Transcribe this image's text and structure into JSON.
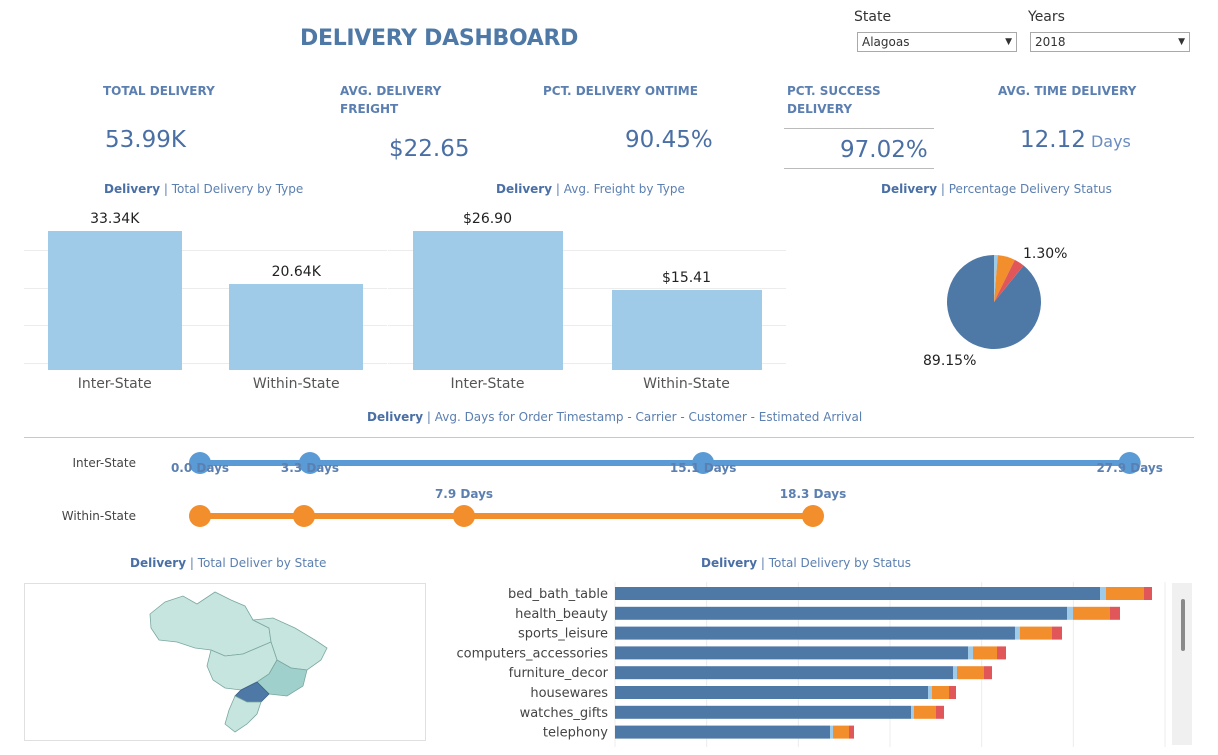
{
  "dashboard": {
    "title": "DELIVERY DASHBOARD"
  },
  "filters": {
    "state": {
      "label": "State",
      "value": "Alagoas"
    },
    "years": {
      "label": "Years",
      "value": "2018"
    }
  },
  "kpis": [
    {
      "label": "TOTAL DELIVERY",
      "value": "53.99K",
      "unit": ""
    },
    {
      "label": "AVG. DELIVERY FREIGHT",
      "value": "$22.65",
      "unit": ""
    },
    {
      "label": "PCT. DELIVERY ONTIME",
      "value": "90.45%",
      "unit": ""
    },
    {
      "label": "PCT. SUCCESS DELIVERY",
      "value": "97.02%",
      "unit": ""
    },
    {
      "label": "AVG. TIME DELIVERY",
      "value": "12.12",
      "unit": "Days"
    }
  ],
  "chart_titles": {
    "prefix": "Delivery",
    "total_by_type": "| Total Delivery by Type",
    "freight_by_type": "| Avg. Freight by Type",
    "status_pct": "| Percentage Delivery Status",
    "avg_days": "| Avg. Days for Order Timestamp - Carrier - Customer - Estimated Arrival",
    "by_state": "| Total Deliver by State",
    "by_status": "| Total Delivery by Status"
  },
  "chart_data": [
    {
      "type": "bar",
      "categories": [
        "Inter-State",
        "Within-State"
      ],
      "values": [
        33.34,
        20.64
      ],
      "value_labels": [
        "33.34K",
        "20.64K"
      ],
      "title": "Delivery | Total Delivery by Type",
      "ylim": [
        0,
        36
      ]
    },
    {
      "type": "bar",
      "categories": [
        "Inter-State",
        "Within-State"
      ],
      "values": [
        26.9,
        15.41
      ],
      "value_labels": [
        "$26.90",
        "$15.41"
      ],
      "title": "Delivery | Avg. Freight by Type",
      "ylim": [
        0,
        29
      ]
    },
    {
      "type": "pie",
      "title": "Delivery | Percentage Delivery Status",
      "slices": [
        {
          "value": 89.15,
          "label": "89.15%",
          "color": "#4e79a7"
        },
        {
          "value": 1.3,
          "label": "1.30%",
          "color": "#a0cbe8"
        },
        {
          "value": 6.0,
          "label": "",
          "color": "#f28e2b"
        },
        {
          "value": 3.55,
          "label": "",
          "color": "#e15759"
        }
      ]
    },
    {
      "type": "line",
      "title": "Delivery | Avg. Days for Order Timestamp - Carrier - Customer - Estimated Arrival",
      "series": [
        {
          "name": "Inter-State",
          "values": [
            0.0,
            3.3,
            15.1,
            27.9
          ],
          "labels": [
            "0.0 Days",
            "3.3 Days",
            "15.1 Days",
            "27.9 Days"
          ],
          "color": "#5b9bd5"
        },
        {
          "name": "Within-State",
          "values": [
            0.0,
            3.1,
            7.9,
            18.3
          ],
          "labels": [
            "",
            "",
            "7.9 Days",
            "18.3 Days"
          ],
          "color": "#f28e2b"
        }
      ],
      "xlim": [
        0,
        28
      ]
    },
    {
      "type": "bar",
      "title": "Delivery | Total Delivery by Status",
      "categories": [
        "bed_bath_table",
        "health_beauty",
        "sports_leisure",
        "computers_accessories",
        "furniture_decor",
        "housewares",
        "watches_gifts",
        "telephony"
      ],
      "series": [
        {
          "name": "",
          "color": "#4e79a7",
          "values": [
            4850,
            4520,
            4000,
            3530,
            3380,
            3130,
            2960,
            2150
          ]
        },
        {
          "name": "",
          "color": "#a0cbe8",
          "values": [
            60,
            60,
            50,
            50,
            40,
            40,
            30,
            30
          ]
        },
        {
          "name": "",
          "color": "#f28e2b",
          "values": [
            380,
            370,
            320,
            240,
            270,
            170,
            220,
            160
          ]
        },
        {
          "name": "",
          "color": "#e15759",
          "values": [
            80,
            100,
            100,
            90,
            80,
            70,
            80,
            50
          ]
        }
      ],
      "xlim": [
        0,
        5500
      ]
    }
  ],
  "map": {
    "highlight_color": "#4e79a7",
    "base_color": "#c6e5de",
    "accent_color": "#9fd0cb"
  }
}
